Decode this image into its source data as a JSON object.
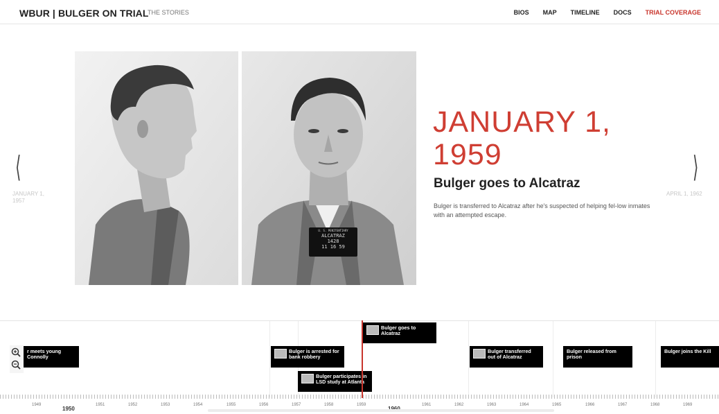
{
  "header": {
    "brand": "WBUR | BULGER ON TRIAL",
    "stories": "THE STORIES",
    "nav": [
      "BIOS",
      "MAP",
      "TIMELINE",
      "DOCS",
      "TRIAL COVERAGE"
    ],
    "active_color": "#c8342b"
  },
  "slide": {
    "date": "JANUARY 1, 1959",
    "date_line1": "JANUARY 1,",
    "date_line2": "1959",
    "title": "Bulger goes to Alcatraz",
    "description": "Bulger is transferred to Alcatraz after he's suspected of helping fel-low inmates with an attempted escape.",
    "photo_placard": [
      "U. S. PENITENTIARY",
      "ALCATRAZ",
      "1428",
      "11 16 59"
    ],
    "prev_date": "JANUARY 1, 1957",
    "next_date": "APRIL 1, 1962"
  },
  "timeline": {
    "events": [
      {
        "label": "r meets young Connolly",
        "thumb": false
      },
      {
        "label": "Bulger is arrested for bank robbery",
        "thumb": true
      },
      {
        "label": "Bulger goes to Alcatraz",
        "thumb": true
      },
      {
        "label": "Bulger participates in LSD study at Atlanta",
        "thumb": true
      },
      {
        "label": "Bulger transferred out of Alcatraz",
        "thumb": true
      },
      {
        "label": "Bulger released from prison",
        "thumb": false
      },
      {
        "label": "Bulger joins the Kill",
        "thumb": false
      }
    ],
    "years": [
      "1949",
      "1950",
      "1951",
      "1952",
      "1953",
      "1954",
      "1955",
      "1956",
      "1957",
      "1958",
      "1959",
      "1960",
      "1961",
      "1962",
      "1963",
      "1964",
      "1965",
      "1966",
      "1967",
      "1968",
      "1969"
    ]
  }
}
